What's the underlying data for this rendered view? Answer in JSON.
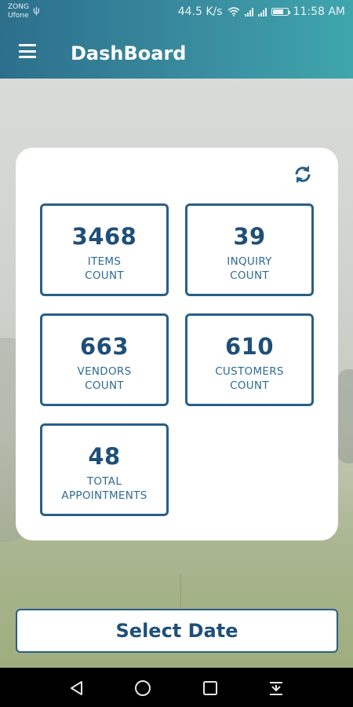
{
  "status_bar": {
    "carrier_1": "ZONG",
    "carrier_2": "Ufone",
    "network_speed": "44.5 K/s",
    "time": "11:58 AM"
  },
  "toolbar": {
    "title": "DashBoard",
    "menu_icon": "hamburger-menu-icon"
  },
  "card": {
    "refresh_icon": "refresh-icon",
    "accent_color": "#2a5f86",
    "tiles": [
      {
        "value": "3468",
        "label_line1": "ITEMS",
        "label_line2": "COUNT"
      },
      {
        "value": "39",
        "label_line1": "INQUIRY",
        "label_line2": "COUNT"
      },
      {
        "value": "663",
        "label_line1": "VENDORS",
        "label_line2": "COUNT"
      },
      {
        "value": "610",
        "label_line1": "CUSTOMERS",
        "label_line2": "COUNT"
      },
      {
        "value": "48",
        "label_line1": "TOTAL",
        "label_line2": "APPOINTMENTS"
      }
    ]
  },
  "select_date_label": "Select Date",
  "colors": {
    "header_start": "#2c6f8c",
    "header_end": "#3fa6ad",
    "text_primary": "#1f4f78"
  },
  "nav": {
    "back_icon": "back-triangle-icon",
    "home_icon": "home-circle-icon",
    "recents_icon": "recents-square-icon",
    "notif_icon": "notification-pull-icon"
  }
}
